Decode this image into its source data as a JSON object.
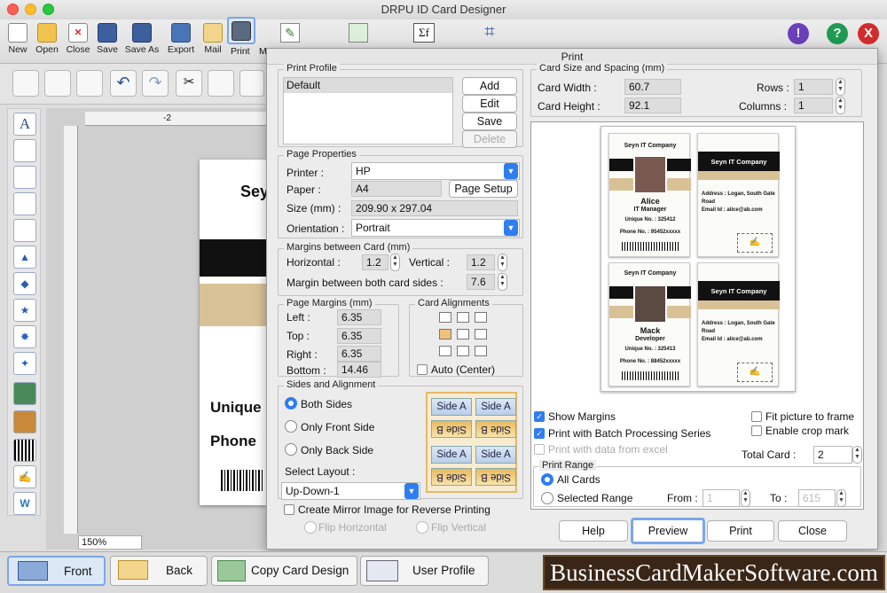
{
  "app": {
    "title": "DRPU ID Card Designer"
  },
  "toolbar": {
    "items": [
      {
        "label": "New",
        "icon": "new-document-icon"
      },
      {
        "label": "Open",
        "icon": "open-folder-icon"
      },
      {
        "label": "Close",
        "icon": "close-document-icon"
      },
      {
        "label": "Save",
        "icon": "save-icon"
      },
      {
        "label": "Save As",
        "icon": "save-as-icon"
      },
      {
        "label": "Export",
        "icon": "export-icon"
      },
      {
        "label": "Mail",
        "icon": "mail-icon"
      },
      {
        "label": "Print",
        "icon": "printer-icon"
      },
      {
        "label": "M",
        "icon": "more-icon"
      }
    ]
  },
  "canvas": {
    "card_text_1": "Sey",
    "card_text_2": "Unique",
    "card_text_3": "Phone",
    "ruler_mark": "-2",
    "zoom": "150%"
  },
  "bottom": {
    "front": "Front",
    "back": "Back",
    "copy": "Copy Card Design",
    "user_profile": "User Profile",
    "watermark": "BusinessCardMakerSoftware.com"
  },
  "dialog": {
    "title": "Print",
    "print_profile": {
      "title": "Print Profile",
      "items": [
        "Default"
      ],
      "add": "Add",
      "edit": "Edit",
      "save": "Save",
      "delete": "Delete"
    },
    "page_properties": {
      "title": "Page Properties",
      "printer_label": "Printer :",
      "printer": "HP",
      "paper_label": "Paper :",
      "paper": "A4",
      "page_setup": "Page Setup",
      "size_label": "Size (mm) :",
      "size": "209.90 x 297.04",
      "orientation_label": "Orientation :",
      "orientation": "Portrait"
    },
    "margins_card": {
      "title": "Margins between Card (mm)",
      "horizontal_label": "Horizontal :",
      "horizontal": "1.2",
      "vertical_label": "Vertical :",
      "vertical": "1.2",
      "both_label": "Margin between both card sides :",
      "both": "7.6"
    },
    "page_margins": {
      "title": "Page Margins (mm)",
      "left_label": "Left :",
      "left": "6.35",
      "top_label": "Top :",
      "top": "6.35",
      "right_label": "Right :",
      "right": "6.35",
      "bottom_label": "Bottom :",
      "bottom": "14.46"
    },
    "card_alignments": {
      "title": "Card Alignments",
      "auto_center": "Auto (Center)"
    },
    "sides": {
      "title": "Sides and Alignment",
      "both": "Both Sides",
      "front": "Only Front Side",
      "back": "Only Back Side",
      "select_layout": "Select Layout :",
      "layout": "Up-Down-1",
      "side_a": "Side A",
      "side_b": "Side B"
    },
    "mirror": {
      "label": "Create Mirror Image for Reverse Printing",
      "flip_h": "Flip Horizontal",
      "flip_v": "Flip Vertical"
    },
    "card_size": {
      "title": "Card Size and Spacing (mm)",
      "width_label": "Card Width :",
      "width": "60.7",
      "height_label": "Card Height :",
      "height": "92.1",
      "rows_label": "Rows :",
      "rows": "1",
      "columns_label": "Columns :",
      "columns": "1"
    },
    "preview_cards": {
      "company": "Seyn IT Company",
      "front1": {
        "name": "Alice",
        "title": "IT Manager",
        "unique": "Unique No. : 325412",
        "phone": "Phone No. : 95452xxxxx"
      },
      "front2": {
        "name": "Mack",
        "title": "Developer",
        "unique": "Unique No. : 325413",
        "phone": "Phone No. : 88452xxxxx"
      },
      "back": {
        "address_label": "Address :",
        "address": "Logan, South Gate Road",
        "email_label": "Email Id :",
        "email": "alice@ab.com"
      }
    },
    "options": {
      "show_margins": "Show Margins",
      "fit_picture": "Fit picture to frame",
      "batch": "Print with Batch Processing Series",
      "crop": "Enable crop mark",
      "excel": "Print with data from excel",
      "total_label": "Total Card :",
      "total": "2"
    },
    "print_range": {
      "title": "Print Range",
      "all": "All Cards",
      "selected": "Selected Range",
      "from_label": "From :",
      "from": "1",
      "to_label": "To :",
      "to": "615"
    },
    "buttons": {
      "help": "Help",
      "preview": "Preview",
      "print": "Print",
      "close": "Close"
    }
  },
  "colors": {
    "accent": "#2f7ef0",
    "danger": "#d42b2b",
    "help": "#1e9a52",
    "info": "#6a3fb8"
  }
}
